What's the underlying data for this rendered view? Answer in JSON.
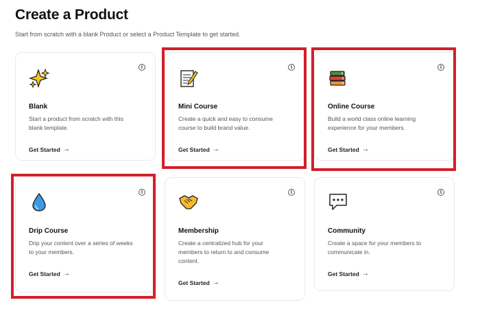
{
  "header": {
    "title": "Create a Product",
    "subtitle": "Start from scratch with a blank Product or select a Product Template to get started."
  },
  "cards": [
    {
      "title": "Blank",
      "desc": "Start a product from scratch with this blank template.",
      "cta": "Get Started",
      "icon": "sparkles-icon"
    },
    {
      "title": "Mini Course",
      "desc": "Create a quick and easy to consume course to build brand value.",
      "cta": "Get Started",
      "icon": "memo-icon"
    },
    {
      "title": "Online Course",
      "desc": "Build a world class online learning experience for your members.",
      "cta": "Get Started",
      "icon": "books-icon"
    },
    {
      "title": "Drip Course",
      "desc": "Drip your content over a series of weeks to your members.",
      "cta": "Get Started",
      "icon": "droplet-icon"
    },
    {
      "title": "Membership",
      "desc": "Create a centralized hub for your members to return to and consume content.",
      "cta": "Get Started",
      "icon": "handshake-icon"
    },
    {
      "title": "Community",
      "desc": "Create a space for your members to communicate in.",
      "cta": "Get Started",
      "icon": "speech-bubble-icon"
    }
  ],
  "common": {
    "info_glyph": "i",
    "arrow_glyph": "→"
  },
  "colors": {
    "highlight": "#d1202a",
    "card_border": "#e9e9ec"
  }
}
